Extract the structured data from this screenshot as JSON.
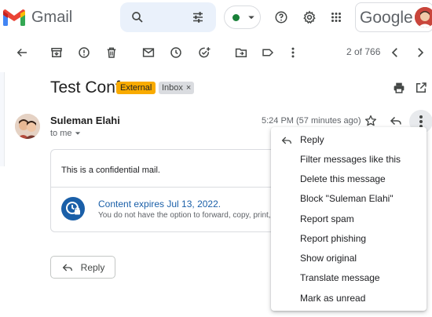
{
  "header": {
    "app_name": "Gmail",
    "google_text": "Google",
    "icons": [
      "gmail-logo-icon",
      "search-icon",
      "filter-sliders-icon",
      "status-dot",
      "caret-down-icon",
      "help-icon",
      "settings-icon",
      "apps-icon",
      "account-avatar"
    ],
    "status_color": "#188038"
  },
  "toolbar": {
    "icons": [
      "back-arrow-icon",
      "archive-icon",
      "report-spam-icon",
      "delete-icon",
      "mark-unread-icon",
      "snooze-icon",
      "add-task-icon",
      "move-to-icon",
      "label-icon",
      "more-vert-icon",
      "chevron-left-icon",
      "chevron-right-icon"
    ],
    "pager": "2 of 766"
  },
  "thread": {
    "subject": "Test Conf",
    "tag_external": "External",
    "tag_inbox": "Inbox",
    "tag_inbox_close": "×",
    "accent_external": "#f9ab00"
  },
  "message": {
    "sender": "Suleman Elahi",
    "recipient": "to me",
    "timestamp": "5:24 PM (57 minutes ago)",
    "body": "This is a confidential mail.",
    "expire_title": "Content expires Jul 13, 2022.",
    "expire_sub": "You do not have the option to forward, copy, print,",
    "reply_label": "Reply"
  },
  "menu": {
    "items": [
      {
        "label": "Reply",
        "icon": "reply-icon"
      },
      {
        "label": "Filter messages like this"
      },
      {
        "label": "Delete this message"
      },
      {
        "label": "Block \"Suleman Elahi\""
      },
      {
        "label": "Report spam"
      },
      {
        "label": "Report phishing"
      },
      {
        "label": "Show original"
      },
      {
        "label": "Translate message"
      },
      {
        "label": "Mark as unread"
      }
    ]
  }
}
